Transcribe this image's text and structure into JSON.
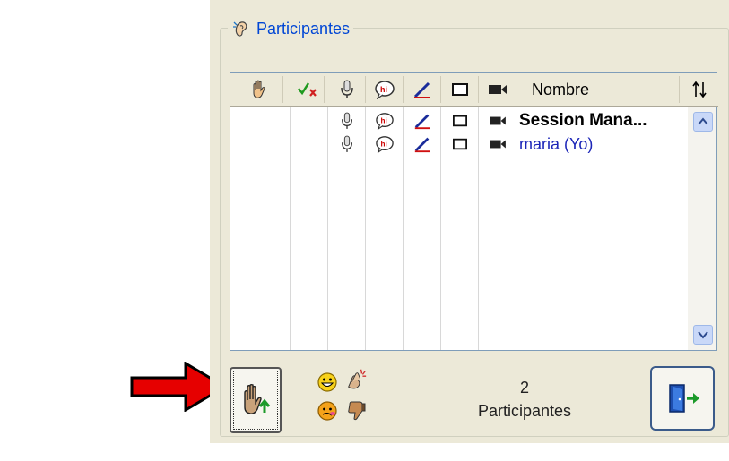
{
  "panel": {
    "title": "Participantes"
  },
  "table": {
    "column_icons": [
      "raise-hand",
      "approve-deny",
      "microphone",
      "chat",
      "pen",
      "whiteboard",
      "video"
    ],
    "name_header": "Nombre",
    "rows": [
      {
        "name": "Session Mana...",
        "style": "bold"
      },
      {
        "name": "maria (Yo)",
        "style": "self"
      }
    ]
  },
  "footer": {
    "count": "2",
    "count_label": "Participantes"
  },
  "colors": {
    "accent": "#0046d5",
    "self_name": "#1c26b8",
    "annotation_arrow": "#e00000"
  }
}
